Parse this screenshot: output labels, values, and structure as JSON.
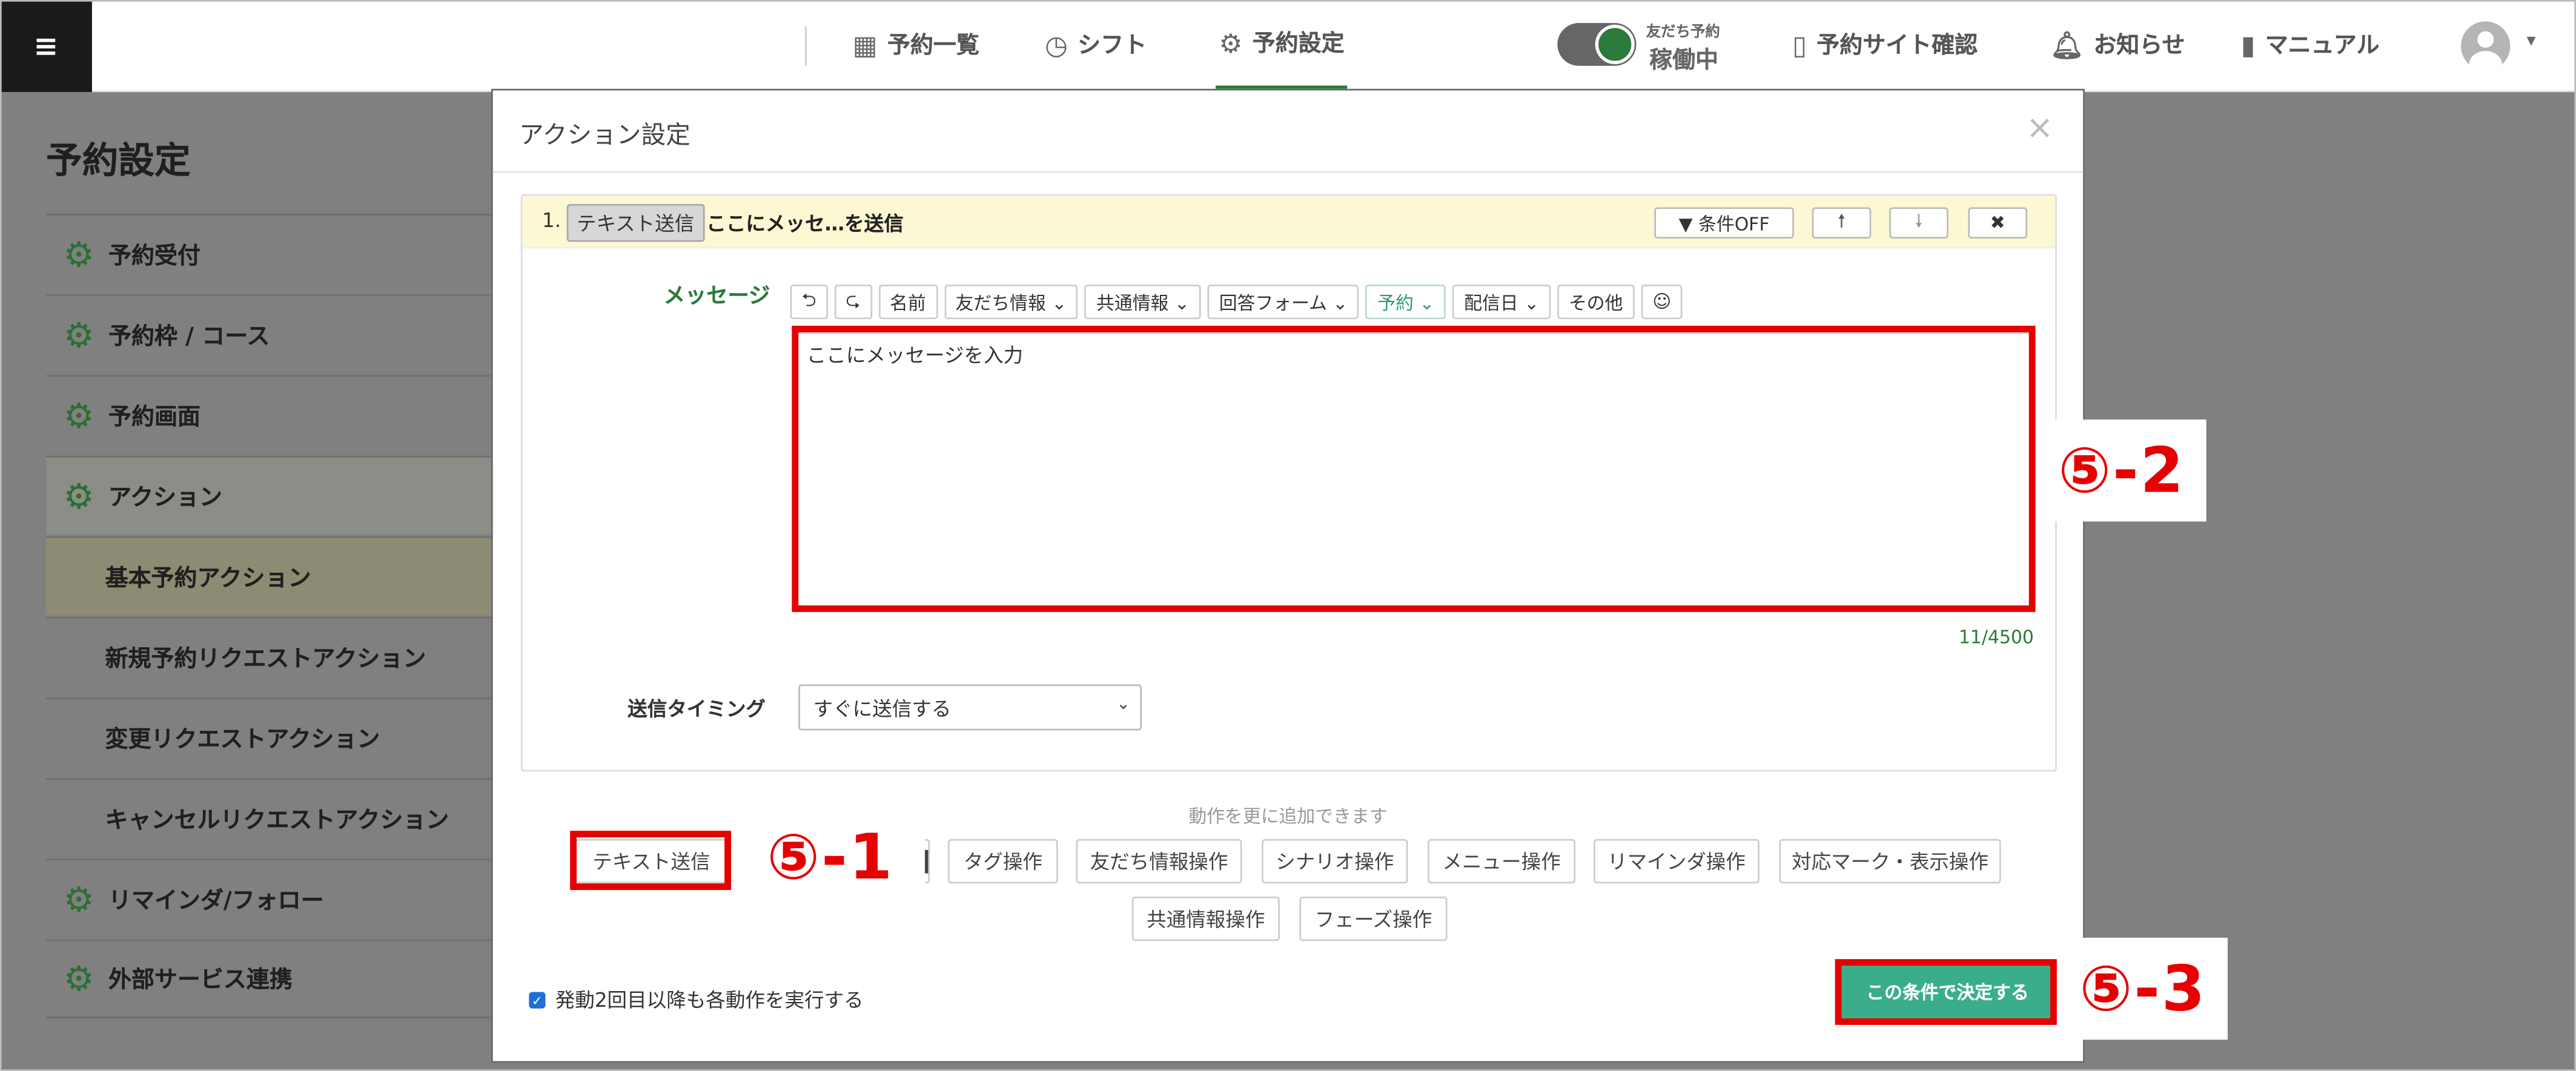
{
  "topbar": {
    "menu_icon": "≡",
    "nav": [
      {
        "label": "予約一覧",
        "icon": "calendar-icon"
      },
      {
        "label": "シフト",
        "icon": "clock-icon"
      },
      {
        "label": "予約設定",
        "icon": "gear-icon"
      }
    ],
    "toggle_caption": "友だち予約",
    "toggle_state": "稼働中",
    "links": [
      {
        "label": "予約サイト確認",
        "icon": "phone-icon"
      },
      {
        "label": "お知らせ",
        "icon": "bell-icon"
      },
      {
        "label": "マニュアル",
        "icon": "book-icon"
      }
    ],
    "accent_color": "#2b7a3b"
  },
  "sidebar": {
    "title": "予約設定",
    "items": [
      {
        "label": "予約受付"
      },
      {
        "label": "予約枠 / コース"
      },
      {
        "label": "予約画面"
      },
      {
        "label": "アクション"
      },
      {
        "label": "基本予約アクション"
      },
      {
        "label": "新規予約リクエストアクション"
      },
      {
        "label": "変更リクエストアクション"
      },
      {
        "label": "キャンセルリクエストアクション"
      },
      {
        "label": "リマインダ/フォロー"
      },
      {
        "label": "外部サービス連携"
      }
    ]
  },
  "modal": {
    "title": "アクション設定",
    "close": "×",
    "card": {
      "number": "1.",
      "type_badge": "テキスト送信",
      "summary": "ここにメッセ…を送信",
      "condition_button": "▼ 条件OFF",
      "up_button": "🠕",
      "down_button": "🠗",
      "delete_button": "✖"
    },
    "message_label": "メッセージ",
    "toolbar": [
      "⮌",
      "⮎",
      "名前",
      "友だち情報 ⌄",
      "共通情報 ⌄",
      "回答フォーム ⌄",
      "予約 ⌄",
      "配信日 ⌄",
      "その他",
      "☺"
    ],
    "message_value": "ここにメッセージを入力",
    "char_count": "11/4500",
    "timing_label": "送信タイミング",
    "timing_value": "すぐに送信する",
    "add_label": "動作を更に追加できます",
    "action_buttons_row1": [
      "テキスト送信",
      "タグ操作",
      "友だち情報操作",
      "シナリオ操作",
      "メニュー操作",
      "リマインダ操作",
      "対応マーク・表示操作"
    ],
    "action_buttons_row2": [
      "共通情報操作",
      "フェーズ操作"
    ],
    "repeat_label": "発動2回目以降も各動作を実行する",
    "submit": "この条件で決定する"
  },
  "annotations": [
    "⑤-1",
    "⑤-2",
    "⑤-3"
  ],
  "highlight_color": "#e60000"
}
